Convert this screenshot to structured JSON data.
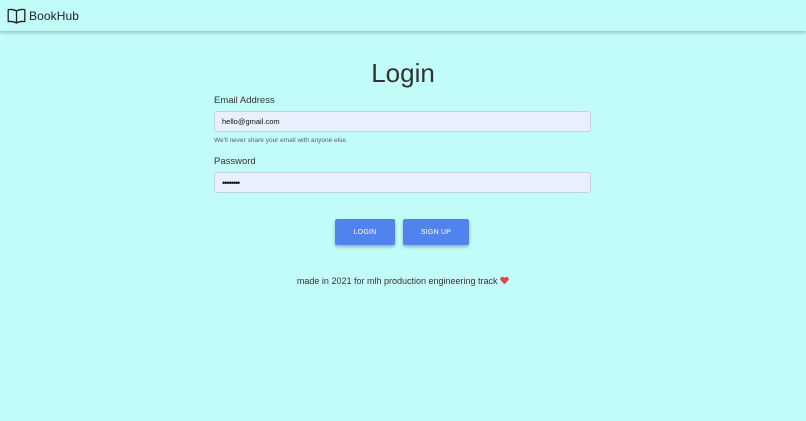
{
  "navbar": {
    "brand_name": "BookHub",
    "brand_icon": "open-book-icon"
  },
  "login": {
    "title": "Login",
    "email_label": "Email Address",
    "email_value": "hello@gmail.com",
    "email_help": "We'll never share your email with anyone else.",
    "password_label": "Password",
    "password_value": "password",
    "login_button": "LOGIN",
    "signup_button": "SIGN UP"
  },
  "footer": {
    "text": "made in 2021 for mlh production engineering track",
    "heart_icon": "heart-icon"
  },
  "colors": {
    "background": "#c2fcf8",
    "button": "#5183ee",
    "input_fill": "#e8f0fe",
    "heart": "#e0444a"
  }
}
